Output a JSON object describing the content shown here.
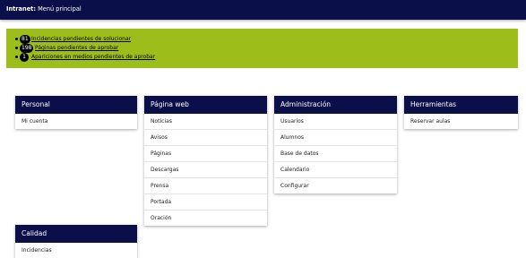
{
  "header": {
    "app": "Intranet:",
    "page": "Menú principal"
  },
  "alerts": [
    {
      "count": "81",
      "label": "Incidencias pendientes de solucionar"
    },
    {
      "count": "198",
      "label": "Páginas pendientes de aprobar"
    },
    {
      "count": "1",
      "label": "Apariciones en medios pendientes de aprobar"
    }
  ],
  "menus": {
    "personal": {
      "title": "Personal",
      "items": [
        "Mi cuenta"
      ]
    },
    "web": {
      "title": "Página web",
      "items": [
        "Noticias",
        "Avisos",
        "Páginas",
        "Descargas",
        "Prensa",
        "Portada",
        "Oración"
      ]
    },
    "admin": {
      "title": "Administración",
      "items": [
        "Usuarios",
        "Alumnos",
        "Base de datos",
        "Calendario",
        "Configurar"
      ]
    },
    "tools": {
      "title": "Herramientas",
      "items": [
        "Reservar aulas"
      ]
    },
    "calidad": {
      "title": "Calidad",
      "items": [
        "Incidencias"
      ]
    }
  },
  "colors": {
    "header_bg": "#0a0f4a",
    "alert_bg": "#9cbd1a"
  }
}
